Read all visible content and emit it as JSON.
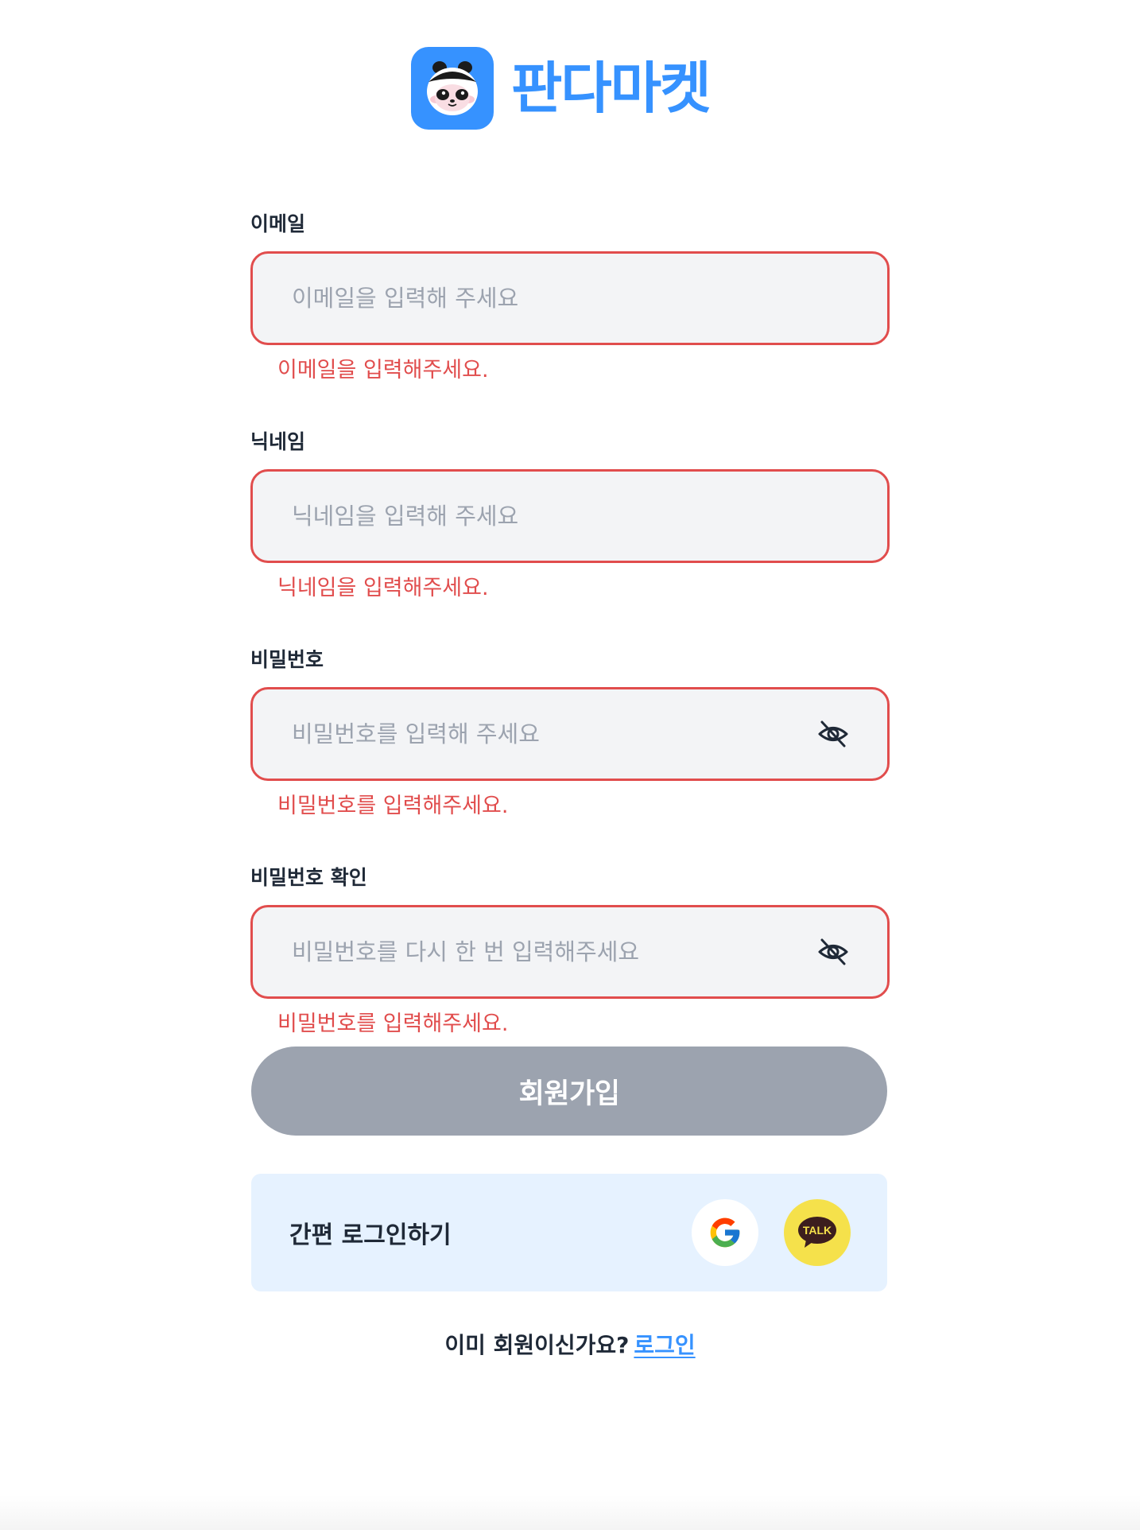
{
  "brand": {
    "name": "판다마켓",
    "color": "#3692ff",
    "logo_icon": "panda-icon"
  },
  "form": {
    "fields": [
      {
        "label": "이메일",
        "placeholder": "이메일을 입력해 주세요",
        "value": "",
        "error": "이메일을 입력해주세요.",
        "type": "email"
      },
      {
        "label": "닉네임",
        "placeholder": "닉네임을 입력해 주세요",
        "value": "",
        "error": "닉네임을 입력해주세요.",
        "type": "text"
      },
      {
        "label": "비밀번호",
        "placeholder": "비밀번호를 입력해 주세요",
        "value": "",
        "error": "비밀번호를 입력해주세요.",
        "type": "password",
        "toggle_icon": "eye-off-icon"
      },
      {
        "label": "비밀번호 확인",
        "placeholder": "비밀번호를 다시 한 번 입력해주세요",
        "value": "",
        "error": "비밀번호를 입력해주세요.",
        "type": "password",
        "toggle_icon": "eye-off-icon"
      }
    ],
    "error_color": "#e14d4d",
    "submit_label": "회원가입",
    "submit_disabled_color": "#9ca3af"
  },
  "easy_login": {
    "label": "간편 로그인하기",
    "providers": [
      {
        "name": "google",
        "icon": "google-icon"
      },
      {
        "name": "kakao",
        "icon": "kakao-talk-icon",
        "icon_text": "TALK"
      }
    ]
  },
  "footer": {
    "question": "이미 회원이신가요?",
    "link_label": "로그인"
  }
}
